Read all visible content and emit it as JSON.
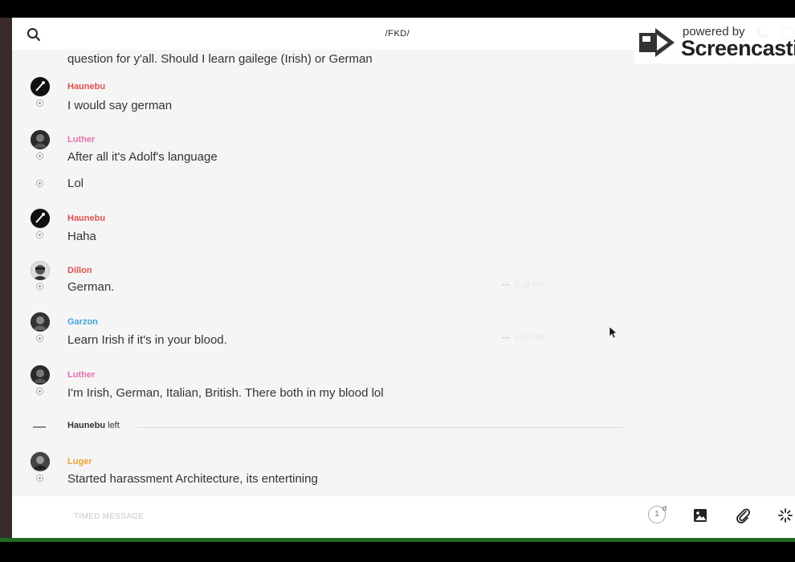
{
  "topbar": {
    "title": "/FKD/"
  },
  "watermark": {
    "small": "powered by",
    "big": "Screencastify"
  },
  "cut_off_message": "question for y'all. Should I learn gailege (Irish) or German",
  "messages": [
    {
      "name": "Haunebu",
      "color": "#d9534f",
      "text": "I would say german",
      "time": ""
    },
    {
      "name": "Luther",
      "color": "#e56fb0",
      "text": "After all it's Adolf's language",
      "time": ""
    },
    {
      "name": "",
      "color": "",
      "text": "Lol",
      "time": ""
    },
    {
      "name": "Haunebu",
      "color": "#d9534f",
      "text": "Haha",
      "time": ""
    },
    {
      "name": "Dillon",
      "color": "#d9534f",
      "text": "German.",
      "time": "6:19 PM"
    },
    {
      "name": "Garzon",
      "color": "#3fa4d8",
      "text": "Learn Irish if it's in your blood.",
      "time": "6:20 PM"
    },
    {
      "name": "Luther",
      "color": "#e56fb0",
      "text": "I'm Irish, German, Italian, British. There both in my blood lol",
      "time": ""
    },
    {
      "name": "Luger",
      "color": "#f0a030",
      "text": "Started harassment Architecture, its entertining",
      "time": ""
    }
  ],
  "system_event": {
    "user": "Haunebu",
    "action": "left"
  },
  "composer": {
    "placeholder": "TIMED MESSAGE",
    "timer_value": "1",
    "timer_unit": "d"
  },
  "icons": [
    "search-icon",
    "phone-icon",
    "info-icon",
    "image-icon",
    "paperclip-icon",
    "sparkle-icon"
  ]
}
